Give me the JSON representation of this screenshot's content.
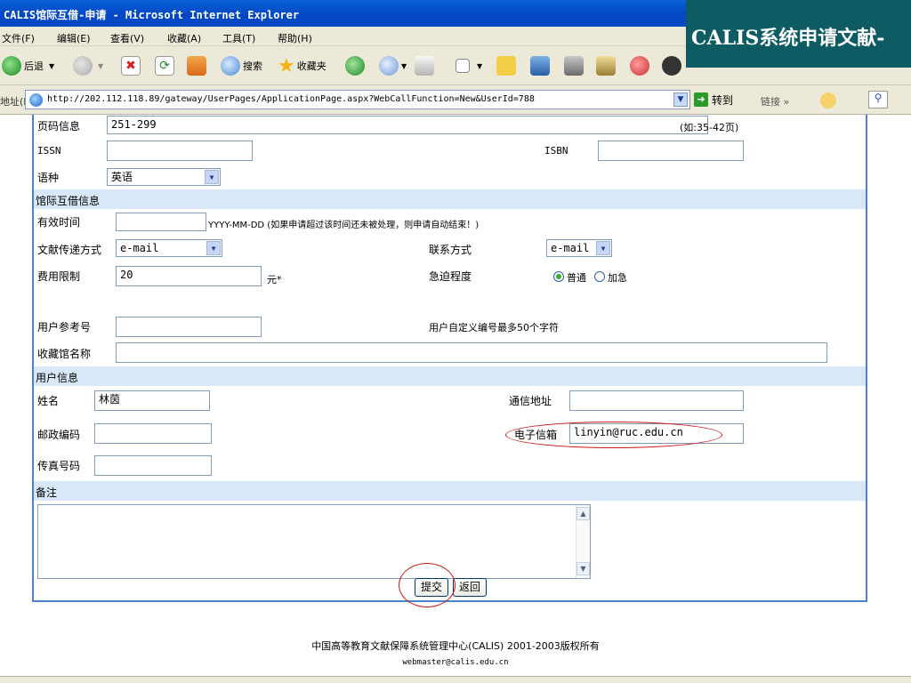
{
  "window": {
    "title": "CALIS馆际互借-申请 - Microsoft Internet Explorer"
  },
  "banner": {
    "text": "CALIS系统申请文献-"
  },
  "menu": [
    "文件(F)",
    "编辑(E)",
    "查看(V)",
    "收藏(A)",
    "工具(T)",
    "帮助(H)"
  ],
  "toolbar": {
    "back": "后退",
    "search": "搜索",
    "favorites": "收藏夹"
  },
  "address": {
    "label": "地址(D)",
    "url": "http://202.112.118.89/gateway/UserPages/ApplicationPage.aspx?WebCallFunction=New&UserId=788",
    "go": "转到",
    "links": "链接 »"
  },
  "form": {
    "page_info": {
      "label": "页码信息",
      "value": "251-299",
      "hint": "(如:35-42页)"
    },
    "issn": {
      "label": "ISSN",
      "value": ""
    },
    "isbn": {
      "label": "ISBN",
      "value": ""
    },
    "language": {
      "label": "语种",
      "value": "英语"
    },
    "ill_section": "馆际互借信息",
    "valid_time": {
      "label": "有效时间",
      "value": "",
      "hint": "YYYY-MM-DD (如果申请超过该时间还未被处理，则申请自动结束！)"
    },
    "delivery": {
      "label": "文献传递方式",
      "value": "e-mail"
    },
    "contact": {
      "label": "联系方式",
      "value": "e-mail"
    },
    "fee_limit": {
      "label": "费用限制",
      "value": "20",
      "unit": "元*"
    },
    "urgency": {
      "label": "急迫程度",
      "options": [
        "普通",
        "加急"
      ],
      "selected": "普通"
    },
    "user_ref": {
      "label": "用户参考号",
      "value": "",
      "hint": "用户自定义编号最多50个字符"
    },
    "library_name": {
      "label": "收藏馆名称",
      "value": ""
    },
    "user_section": "用户信息",
    "name": {
      "label": "姓名",
      "value": "林茵"
    },
    "mail_address": {
      "label": "通信地址",
      "value": ""
    },
    "postcode": {
      "label": "邮政编码",
      "value": ""
    },
    "email": {
      "label": "电子信箱",
      "value": "linyin@ruc.edu.cn"
    },
    "fax": {
      "label": "传真号码",
      "value": ""
    },
    "remarks_section": "备注",
    "remarks": {
      "value": ""
    },
    "submit": "提交",
    "back": "返回"
  },
  "footer": {
    "copyright": "中国高等教育文献保障系统管理中心(CALIS) 2001-2003版权所有",
    "email": "webmaster@calis.edu.cn"
  }
}
